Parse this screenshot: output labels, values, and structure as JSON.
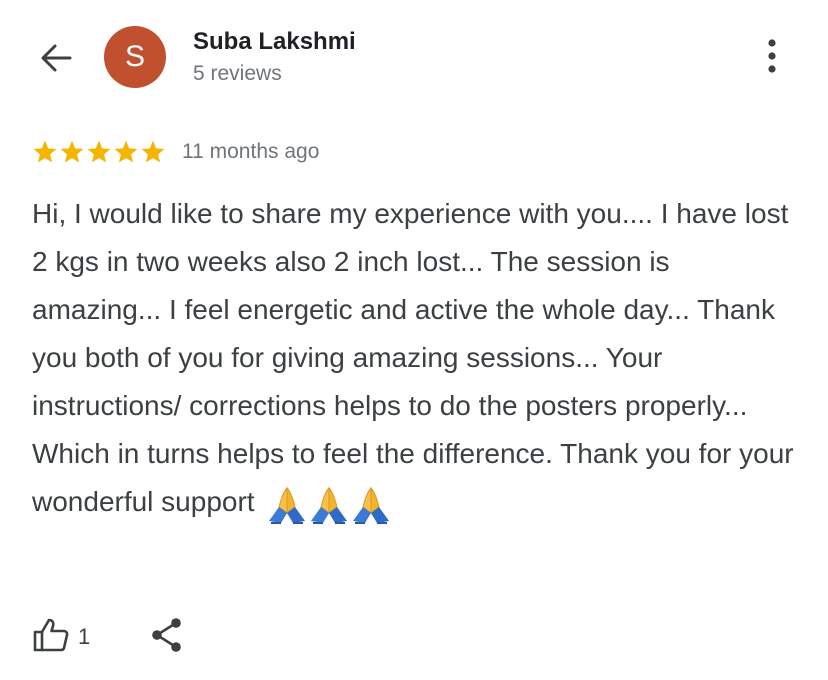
{
  "header": {
    "back_icon": "arrow-left-icon",
    "avatar_letter": "S",
    "avatar_color": "#c0502e",
    "name": "Suba Lakshmi",
    "reviews_count": "5 reviews",
    "more_icon": "more-vertical-icon"
  },
  "review": {
    "rating": 5,
    "star_color": "#f4b400",
    "time": "11 months ago",
    "text": "Hi, I would like to share my experience with you.... I have lost 2 kgs in two weeks also 2 inch lost... The session is amazing... I feel energetic and active the whole day... Thank you both of you for giving amazing sessions... Your instructions/ corrections helps to do the posters properly... Which in turns helps to feel the difference. Thank you for your wonderful support",
    "emoji": "🙏🙏🙏"
  },
  "actions": {
    "like_icon": "thumbs-up-icon",
    "like_count": "1",
    "share_icon": "share-icon"
  }
}
